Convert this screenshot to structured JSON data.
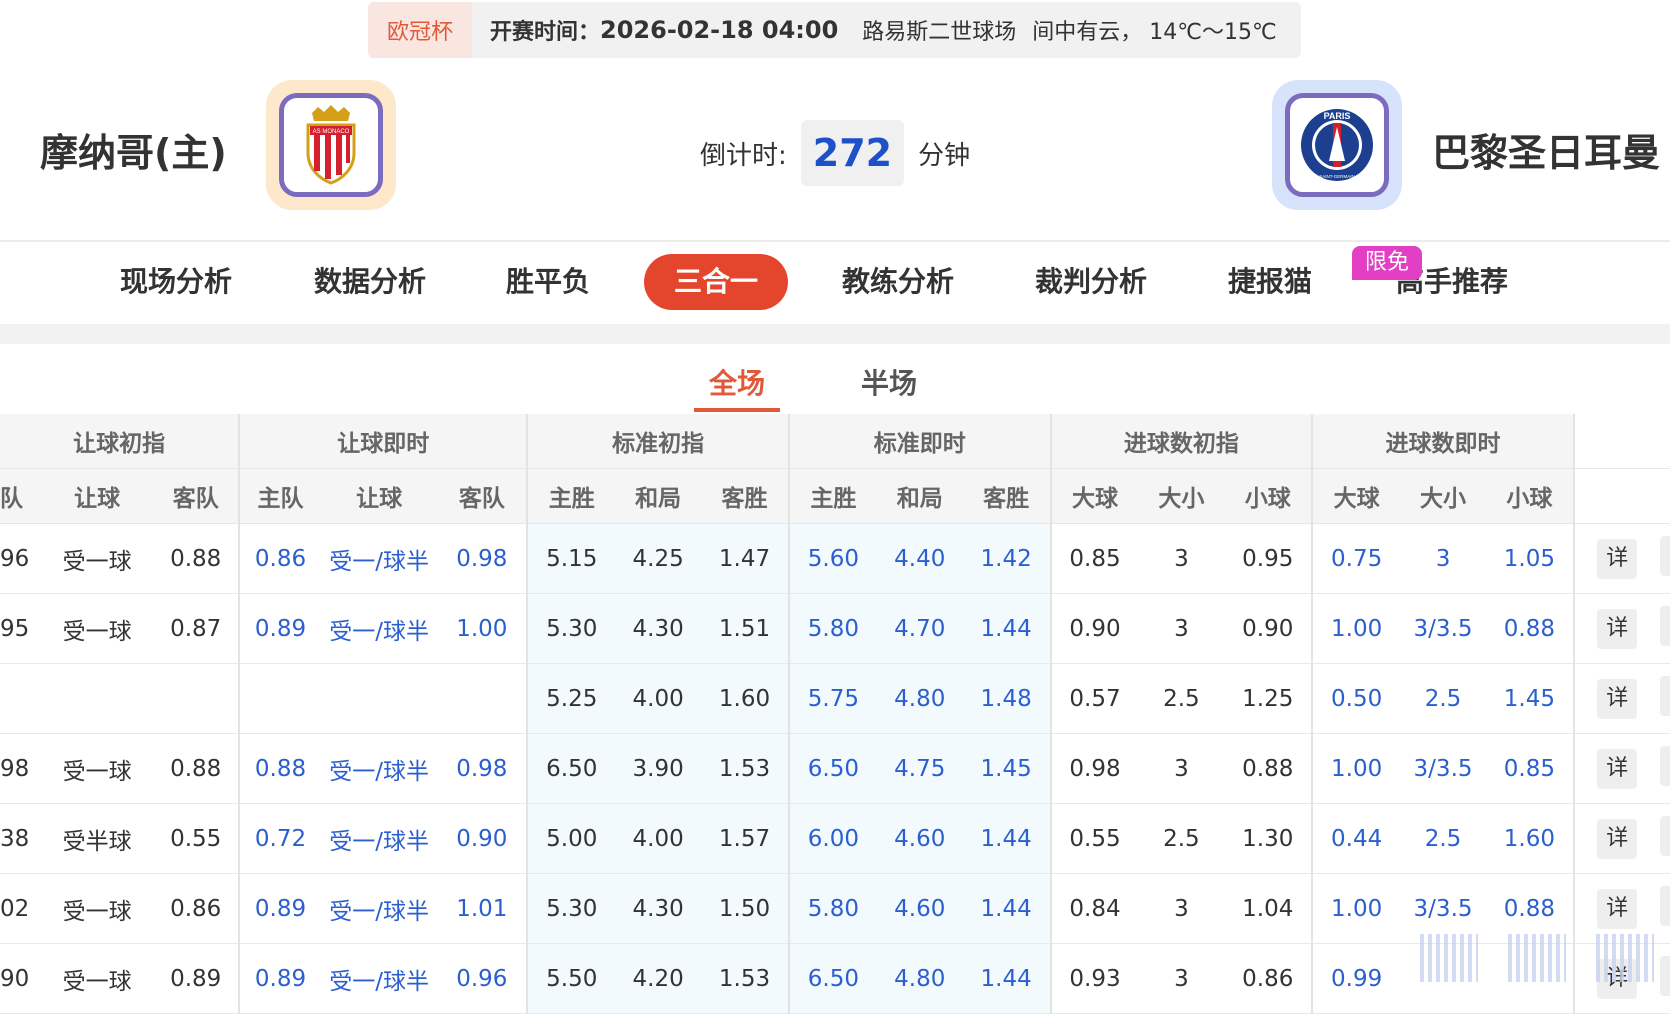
{
  "info": {
    "competition": "欧冠杯",
    "time_label": "开赛时间：",
    "time": "2026-02-18 04:00",
    "venue": "路易斯二世球场",
    "weather": "间中有云， 14℃～15℃"
  },
  "home": {
    "name": "摩纳哥(主)",
    "badge_text": "AS MONACO"
  },
  "away": {
    "name": "巴黎圣日耳曼",
    "badge_text": "PARIS",
    "badge_sub": "SAINT-GERMAIN"
  },
  "countdown": {
    "label": "倒计时:",
    "value": "272",
    "unit": "分钟"
  },
  "nav": {
    "items": [
      "现场分析",
      "数据分析",
      "胜平负",
      "三合一",
      "教练分析",
      "裁判分析",
      "捷报猫",
      "高手推荐"
    ],
    "active": "三合一",
    "free_badge": "限免"
  },
  "subtabs": {
    "full": "全场",
    "half": "半场"
  },
  "table": {
    "groups": [
      "让球初指",
      "让球即时",
      "标准初指",
      "标准即时",
      "进球数初指",
      "进球数即时"
    ],
    "subheaders": [
      "队",
      "让球",
      "客队",
      "主队",
      "让球",
      "客队",
      "主胜",
      "和局",
      "客胜",
      "主胜",
      "和局",
      "客胜",
      "大球",
      "大小",
      "小球",
      "大球",
      "大小",
      "小球"
    ],
    "detail_label": "详",
    "rows": [
      [
        "96",
        "受一球",
        "0.88",
        "0.86",
        "受一/球半",
        "0.98",
        "5.15",
        "4.25",
        "1.47",
        "5.60",
        "4.40",
        "1.42",
        "0.85",
        "3",
        "0.95",
        "0.75",
        "3",
        "1.05"
      ],
      [
        "95",
        "受一球",
        "0.87",
        "0.89",
        "受一/球半",
        "1.00",
        "5.30",
        "4.30",
        "1.51",
        "5.80",
        "4.70",
        "1.44",
        "0.90",
        "3",
        "0.90",
        "1.00",
        "3/3.5",
        "0.88"
      ],
      [
        "",
        "",
        "",
        "",
        "",
        "",
        "5.25",
        "4.00",
        "1.60",
        "5.75",
        "4.80",
        "1.48",
        "0.57",
        "2.5",
        "1.25",
        "0.50",
        "2.5",
        "1.45"
      ],
      [
        "98",
        "受一球",
        "0.88",
        "0.88",
        "受一/球半",
        "0.98",
        "6.50",
        "3.90",
        "1.53",
        "6.50",
        "4.75",
        "1.45",
        "0.98",
        "3",
        "0.88",
        "1.00",
        "3/3.5",
        "0.85"
      ],
      [
        "38",
        "受半球",
        "0.55",
        "0.72",
        "受一/球半",
        "0.90",
        "5.00",
        "4.00",
        "1.57",
        "6.00",
        "4.60",
        "1.44",
        "0.55",
        "2.5",
        "1.30",
        "0.44",
        "2.5",
        "1.60"
      ],
      [
        "02",
        "受一球",
        "0.86",
        "0.89",
        "受一/球半",
        "1.01",
        "5.30",
        "4.30",
        "1.50",
        "5.80",
        "4.60",
        "1.44",
        "0.84",
        "3",
        "1.04",
        "1.00",
        "3/3.5",
        "0.88"
      ],
      [
        "90",
        "受一球",
        "0.89",
        "0.89",
        "受一/球半",
        "0.96",
        "5.50",
        "4.20",
        "1.53",
        "6.50",
        "4.80",
        "1.44",
        "0.93",
        "3",
        "0.86",
        "0.99",
        "",
        ""
      ]
    ]
  }
}
